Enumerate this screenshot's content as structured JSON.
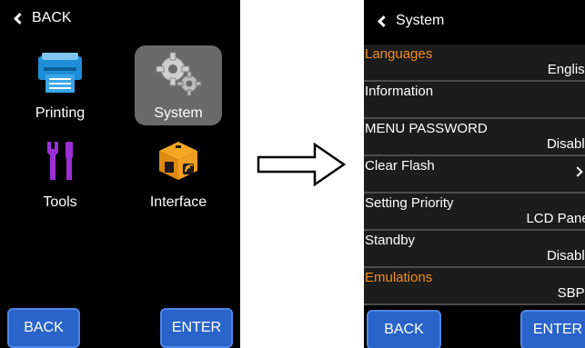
{
  "left_screen": {
    "back_label": "BACK",
    "tiles": [
      {
        "label": "Printing",
        "icon": "printer-icon",
        "selected": false
      },
      {
        "label": "System",
        "icon": "gears-icon",
        "selected": true
      },
      {
        "label": "Tools",
        "icon": "tools-icon",
        "selected": false
      },
      {
        "label": "Interface",
        "icon": "interface-box-icon",
        "selected": false
      }
    ],
    "buttons": {
      "back": "BACK",
      "enter": "ENTER"
    }
  },
  "right_screen": {
    "title": "System",
    "rows": [
      {
        "name": "Languages",
        "value": "English",
        "highlight": true
      },
      {
        "name": "Information",
        "value": "",
        "highlight": false
      },
      {
        "name": "MENU PASSWORD",
        "value": "Disable",
        "highlight": false
      },
      {
        "name": "Clear Flash",
        "value": "",
        "highlight": false
      },
      {
        "name": "Setting Priority",
        "value": "LCD Panel",
        "highlight": false
      },
      {
        "name": "Standby",
        "value": "Disable",
        "highlight": false
      },
      {
        "name": "Emulations",
        "value": "SBPL",
        "highlight": true
      }
    ],
    "buttons": {
      "back": "BACK",
      "enter": "ENTER"
    }
  },
  "colors": {
    "accent_orange": "#f28c1d",
    "button_blue": "#2a63c9",
    "selected_tile": "#6a6a6a"
  }
}
